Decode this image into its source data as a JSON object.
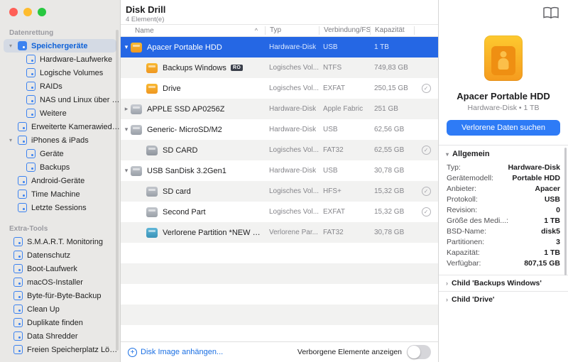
{
  "header": {
    "title": "Disk Drill",
    "subtitle": "4 Element(e)"
  },
  "sidebar": {
    "sections": [
      {
        "title": "Datenrettung",
        "items": [
          {
            "label": "Speichergeräte"
          },
          {
            "label": "Hardware-Laufwerke"
          },
          {
            "label": "Logische Volumes"
          },
          {
            "label": "RAIDs"
          },
          {
            "label": "NAS und Linux über SSH"
          },
          {
            "label": "Weitere"
          },
          {
            "label": "Erweiterte Kamerawiederh..."
          },
          {
            "label": "iPhones & iPads"
          },
          {
            "label": "Geräte"
          },
          {
            "label": "Backups"
          },
          {
            "label": "Android-Geräte"
          },
          {
            "label": "Time Machine"
          },
          {
            "label": "Letzte Sessions"
          }
        ]
      },
      {
        "title": "Extra-Tools",
        "items": [
          {
            "label": "S.M.A.R.T. Monitoring"
          },
          {
            "label": "Datenschutz"
          },
          {
            "label": "Boot-Laufwerk"
          },
          {
            "label": "macOS-Installer"
          },
          {
            "label": "Byte-für-Byte-Backup"
          },
          {
            "label": "Clean Up"
          },
          {
            "label": "Duplikate finden"
          },
          {
            "label": "Data Shredder"
          },
          {
            "label": "Freien Speicherplatz Lösc..."
          }
        ]
      }
    ]
  },
  "table": {
    "columns": {
      "name": "Name",
      "type": "Typ",
      "connection": "Verbindung/FS",
      "capacity": "Kapazität"
    },
    "sort_indicator": "^",
    "rows": [
      {
        "name": "Apacer Portable HDD",
        "type": "Hardware-Disk",
        "connection": "USB",
        "capacity": "1 TB",
        "icon": "orange-hdd"
      },
      {
        "name": "Backups Windows",
        "badge": "RO",
        "type": "Logisches Vol...",
        "connection": "NTFS",
        "capacity": "749,83 GB",
        "icon": "orange-volume"
      },
      {
        "name": "Drive",
        "type": "Logisches Vol...",
        "connection": "EXFAT",
        "capacity": "250,15 GB",
        "icon": "orange-volume"
      },
      {
        "name": "APPLE SSD AP0256Z",
        "type": "Hardware-Disk",
        "connection": "Apple Fabric",
        "capacity": "251 GB",
        "icon": "gray-ssd"
      },
      {
        "name": "Generic- MicroSD/M2",
        "type": "Hardware-Disk",
        "connection": "USB",
        "capacity": "62,56 GB",
        "icon": "gray-drive"
      },
      {
        "name": "SD CARD",
        "type": "Logisches Vol...",
        "connection": "FAT32",
        "capacity": "62,55 GB",
        "icon": "sd-card"
      },
      {
        "name": "USB SanDisk 3.2Gen1",
        "type": "Hardware-Disk",
        "connection": "USB",
        "capacity": "30,78 GB",
        "icon": "gray-drive"
      },
      {
        "name": "SD card",
        "type": "Logisches Vol...",
        "connection": "HFS+",
        "capacity": "15,32 GB",
        "icon": "gray-volume"
      },
      {
        "name": "Second Part",
        "type": "Logisches Vol...",
        "connection": "EXFAT",
        "capacity": "15,32 GB",
        "icon": "gray-volume"
      },
      {
        "name": "Verlorene Partition *NEW VOL...",
        "type": "Verlorene Par...",
        "connection": "FAT32",
        "capacity": "30,78 GB",
        "icon": "teal-lost"
      }
    ],
    "check_glyph": "✓"
  },
  "footer": {
    "attach_image": "Disk Image anhängen...",
    "hidden_items": "Verborgene Elemente anzeigen",
    "toggle_state": "off"
  },
  "detail": {
    "device_name": "Apacer Portable HDD",
    "device_subtitle": "Hardware-Disk • 1 TB",
    "search_button": "Verlorene Daten suchen",
    "section_general": "Allgemein",
    "properties": [
      {
        "label": "Typ:",
        "value": "Hardware-Disk"
      },
      {
        "label": "Gerätemodell:",
        "value": "Portable HDD"
      },
      {
        "label": "Anbieter:",
        "value": "Apacer"
      },
      {
        "label": "Protokoll:",
        "value": "USB"
      },
      {
        "label": "Revision:",
        "value": "0"
      },
      {
        "label": "Größe des Medi...:",
        "value": "1 TB"
      },
      {
        "label": "BSD-Name:",
        "value": "disk5"
      },
      {
        "label": "Partitionen:",
        "value": "3"
      },
      {
        "label": "Kapazität:",
        "value": "1 TB"
      },
      {
        "label": "Verfügbar:",
        "value": "807,15 GB"
      }
    ],
    "children": [
      "Child 'Backups Windows'",
      "Child 'Drive'"
    ]
  },
  "colors": {
    "selection_blue": "#2567e4",
    "accent_blue": "#2e7bf6",
    "sidebar_selected_text": "#0f62d8",
    "orange_drive": "#f5a01e"
  }
}
